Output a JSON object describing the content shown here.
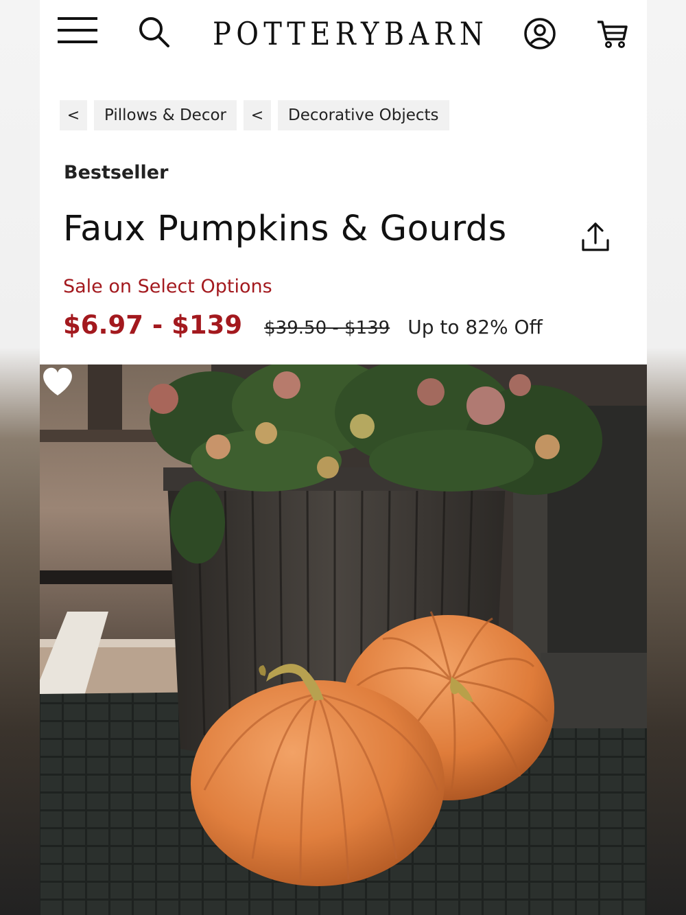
{
  "header": {
    "brand": [
      "P",
      "O",
      "T",
      "T",
      "E",
      "R",
      "Y",
      "B",
      "A",
      "R",
      "N"
    ],
    "icons": [
      "menu-icon",
      "search-icon",
      "account-icon",
      "cart-icon"
    ]
  },
  "breadcrumb": {
    "back_glyph": "<",
    "items": [
      "Pillows & Decor",
      "Decorative Objects"
    ]
  },
  "product": {
    "badge": "Bestseller",
    "title": "Faux Pumpkins & Gourds",
    "sale_note": "Sale on Select Options",
    "price_range": "$6.97 - $139",
    "original_price": "$39.50 - $139",
    "discount": "Up to 82% Off"
  },
  "colors": {
    "sale_red": "#a3191e",
    "text": "#111111",
    "crumb_bg": "#f1f1f1"
  },
  "hero": {
    "favorite_icon": "heart-icon"
  }
}
